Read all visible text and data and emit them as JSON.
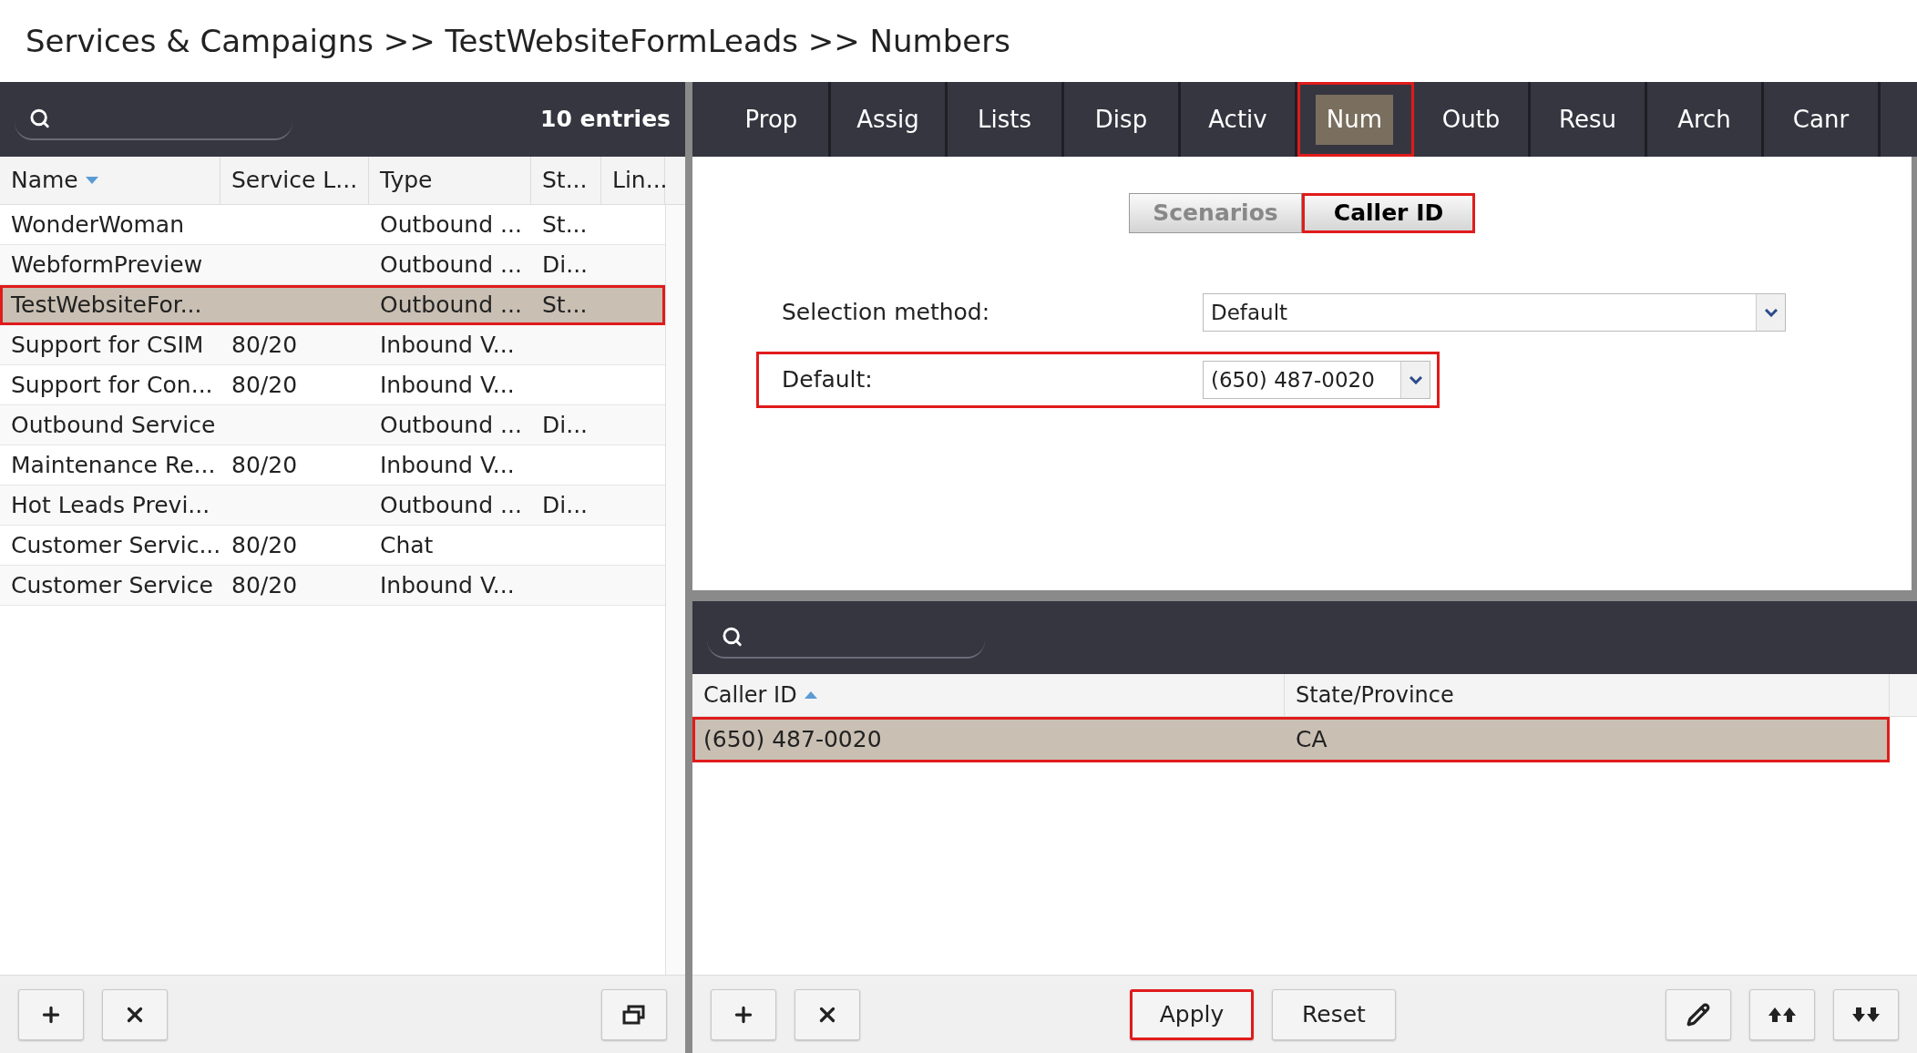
{
  "breadcrumb": "Services & Campaigns >> TestWebsiteFormLeads >> Numbers",
  "services": {
    "entries": "10 entries",
    "columns": [
      {
        "label": "Name",
        "sort_ascending": false
      },
      {
        "label": "Service L..."
      },
      {
        "label": "Type"
      },
      {
        "label": "St..."
      },
      {
        "label": "Lin..."
      }
    ],
    "rows": [
      {
        "cells": [
          "WonderWoman",
          "",
          "Outbound ...",
          "St...",
          ""
        ],
        "selected": false,
        "highlighted": false
      },
      {
        "cells": [
          "WebformPreview",
          "",
          "Outbound ...",
          "Di...",
          ""
        ],
        "selected": false,
        "highlighted": false
      },
      {
        "cells": [
          "TestWebsiteFor...",
          "",
          "Outbound ...",
          "St...",
          ""
        ],
        "selected": true,
        "highlighted": true
      },
      {
        "cells": [
          "Support for CSIM",
          "80/20",
          "Inbound V...",
          "",
          ""
        ],
        "selected": false,
        "highlighted": false
      },
      {
        "cells": [
          "Support for Con...",
          "80/20",
          "Inbound V...",
          "",
          ""
        ],
        "selected": false,
        "highlighted": false
      },
      {
        "cells": [
          "Outbound Service",
          "",
          "Outbound ...",
          "Di...",
          ""
        ],
        "selected": false,
        "highlighted": false
      },
      {
        "cells": [
          "Maintenance Re...",
          "80/20",
          "Inbound V...",
          "",
          ""
        ],
        "selected": false,
        "highlighted": false
      },
      {
        "cells": [
          "Hot Leads Previ...",
          "",
          "Outbound ...",
          "Di...",
          ""
        ],
        "selected": false,
        "highlighted": false
      },
      {
        "cells": [
          "Customer Servic...",
          "80/20",
          "Chat",
          "",
          ""
        ],
        "selected": false,
        "highlighted": false
      },
      {
        "cells": [
          "Customer Service",
          "80/20",
          "Inbound V...",
          "",
          ""
        ],
        "selected": false,
        "highlighted": false
      }
    ],
    "toolbar": [
      {
        "kind": "add"
      },
      {
        "kind": "delete"
      },
      {
        "kind": "window"
      }
    ]
  },
  "tabs": [
    {
      "label": "Prop",
      "selected": false,
      "highlighted": false
    },
    {
      "label": "Assig",
      "selected": false,
      "highlighted": false
    },
    {
      "label": "Lists",
      "selected": false,
      "highlighted": false
    },
    {
      "label": "Disp",
      "selected": false,
      "highlighted": false
    },
    {
      "label": "Activ",
      "selected": false,
      "highlighted": false
    },
    {
      "label": "Num",
      "selected": true,
      "highlighted": true
    },
    {
      "label": "Outb",
      "selected": false,
      "highlighted": false
    },
    {
      "label": "Resu",
      "selected": false,
      "highlighted": false
    },
    {
      "label": "Arch",
      "selected": false,
      "highlighted": false
    },
    {
      "label": "Canr",
      "selected": false,
      "highlighted": false
    }
  ],
  "subtabs": [
    {
      "label": "Scenarios",
      "selected": false,
      "highlighted": false
    },
    {
      "label": "Caller ID",
      "selected": true,
      "highlighted": true
    }
  ],
  "form": [
    {
      "label": "Selection method:",
      "value": "Default",
      "wide": true,
      "highlighted": false
    },
    {
      "label": "Default:",
      "value": "(650) 487-0020",
      "wide": false,
      "highlighted": true
    }
  ],
  "caller_ids": {
    "columns": [
      {
        "label": "Caller ID",
        "sort_ascending": true
      },
      {
        "label": "State/Province"
      }
    ],
    "rows": [
      {
        "cells": [
          "(650) 487-0020",
          "CA"
        ],
        "selected": true,
        "highlighted": true
      }
    ],
    "toolbar": [
      {
        "kind": "add"
      },
      {
        "kind": "delete"
      },
      {
        "kind": "text",
        "label": "Apply",
        "highlighted": true
      },
      {
        "kind": "text",
        "label": "Reset",
        "highlighted": false
      },
      {
        "kind": "edit"
      },
      {
        "kind": "top"
      },
      {
        "kind": "bottom"
      }
    ]
  }
}
